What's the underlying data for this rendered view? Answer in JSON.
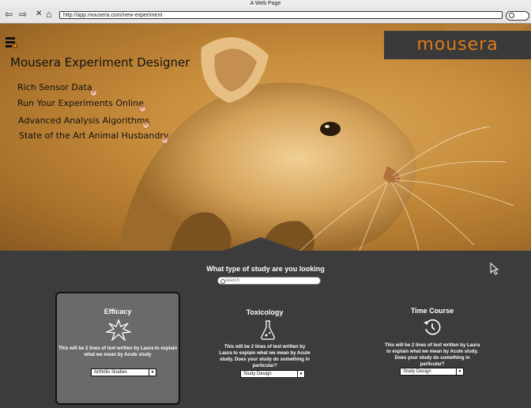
{
  "browser": {
    "window_title": "A Web Page",
    "url": "http://app.mousera.com/new-experiment",
    "nav": {
      "back": "⇦",
      "forward": "⇨",
      "stop": "✕",
      "home": "⌂"
    }
  },
  "brand": {
    "name": "mousera",
    "color": "#e07b17"
  },
  "hero": {
    "title": "Mousera Experiment Designer",
    "features": [
      "Rich Sensor Data",
      "Run Your Experiments Online",
      "Advanced Analysis Algorithms",
      "State of the Art Animal Husbandry"
    ],
    "badge": "P"
  },
  "study": {
    "question": "What type of study are you looking",
    "search_placeholder": "search"
  },
  "cards": [
    {
      "title": "Efficacy",
      "icon": "starburst-icon",
      "description": "This will be 2 lines of text written by Laura to explain what we mean by Acute study",
      "select_value": "Arthritis Studies",
      "selected": true
    },
    {
      "title": "Toxicology",
      "icon": "flask-icon",
      "description": "This will be 2 lines of text written by Laura to explain what we mean by Acute study. Does your study do something in particular?",
      "select_value": "Study Design",
      "selected": false
    },
    {
      "title": "Time Course",
      "icon": "clock-reverse-icon",
      "description": "This will be 2 lines of text written by Laura to explain what we mean by Acute study. Does your study do something in particular?",
      "select_value": "Study Design",
      "selected": false
    }
  ]
}
